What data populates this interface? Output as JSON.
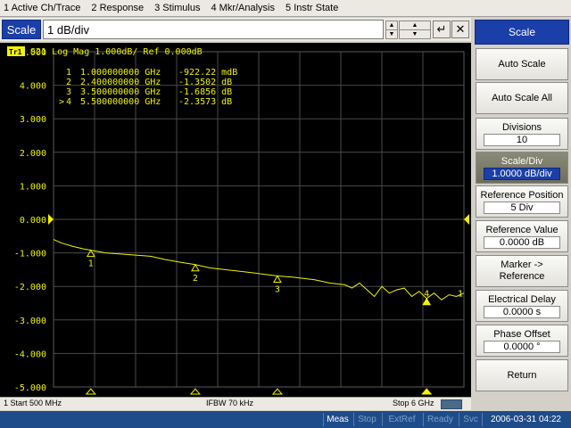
{
  "menu": [
    "1 Active Ch/Trace",
    "2 Response",
    "3 Stimulus",
    "4 Mkr/Analysis",
    "5 Instr State"
  ],
  "entry": {
    "label": "Scale",
    "value": "1 dB/div"
  },
  "trace": {
    "tag": "Tr1",
    "header": "S21 Log Mag 1.000dB/ Ref 0.000dB",
    "color": "#f2f200"
  },
  "markers": [
    {
      "num": "1",
      "prefix": " ",
      "freq": "1.000000000 GHz",
      "value": "-922.22 mdB"
    },
    {
      "num": "2",
      "prefix": " ",
      "freq": "2.400000000 GHz",
      "value": "-1.3502 dB"
    },
    {
      "num": "3",
      "prefix": " ",
      "freq": "3.500000000 GHz",
      "value": "-1.6856 dB"
    },
    {
      "num": "4",
      "prefix": ">",
      "freq": "5.500000000 GHz",
      "value": "-2.3573 dB"
    }
  ],
  "chart_data": {
    "type": "line",
    "y_ticks": [
      "5.000",
      "4.000",
      "3.000",
      "2.000",
      "1.000",
      "0.000",
      "-1.000",
      "-2.000",
      "-3.000",
      "-4.000",
      "-5.000"
    ],
    "ylim": [
      -5,
      5
    ],
    "xlim": [
      0.5,
      6
    ],
    "x_unit": "GHz",
    "grid": true,
    "reference_level": 0,
    "series": [
      {
        "x": [
          0.5,
          0.6,
          0.75,
          0.9,
          1.0,
          1.2,
          1.5,
          1.8,
          2.0,
          2.2,
          2.4,
          2.6,
          2.8,
          3.0,
          3.2,
          3.5,
          3.7,
          4.0,
          4.2,
          4.4,
          4.5,
          4.6,
          4.7,
          4.8,
          4.9,
          5.0,
          5.1,
          5.2,
          5.3,
          5.4,
          5.5,
          5.6,
          5.7,
          5.8,
          5.9,
          6.0
        ],
        "y": [
          -0.6,
          -0.7,
          -0.8,
          -0.88,
          -0.92,
          -1.0,
          -1.05,
          -1.1,
          -1.2,
          -1.28,
          -1.35,
          -1.45,
          -1.5,
          -1.55,
          -1.6,
          -1.69,
          -1.72,
          -1.8,
          -1.9,
          -1.95,
          -2.05,
          -1.9,
          -2.1,
          -2.3,
          -2.0,
          -2.2,
          -2.1,
          -2.05,
          -2.3,
          -2.15,
          -2.36,
          -2.2,
          -2.4,
          -2.25,
          -2.3,
          -2.2
        ]
      }
    ],
    "marker_points": [
      {
        "label": "1",
        "x": 1.0,
        "y": -0.92
      },
      {
        "label": "2",
        "x": 2.4,
        "y": -1.35
      },
      {
        "label": "3",
        "x": 3.5,
        "y": -1.69
      },
      {
        "label": "4",
        "x": 5.5,
        "y": -2.36
      }
    ]
  },
  "status": {
    "start": "1  Start 500 MHz",
    "ifbw": "IFBW 70 kHz",
    "stop": "Stop 6 GHz"
  },
  "bottom": {
    "cells": [
      "Meas",
      "Stop",
      "ExtRef",
      "Ready",
      "Svc"
    ],
    "datetime": "2006-03-31 04:22"
  },
  "softkeys": {
    "title": "Scale",
    "auto_scale": "Auto Scale",
    "auto_scale_all": "Auto Scale All",
    "divisions_label": "Divisions",
    "divisions_value": "10",
    "scale_div_label": "Scale/Div",
    "scale_div_value": "1.0000 dB/div",
    "ref_pos_label": "Reference Position",
    "ref_pos_value": "5 Div",
    "ref_val_label": "Reference Value",
    "ref_val_value": "0.0000 dB",
    "marker_ref_line1": "Marker ->",
    "marker_ref_line2": "Reference",
    "elec_delay_label": "Electrical Delay",
    "elec_delay_value": "0.0000 s",
    "phase_offset_label": "Phase Offset",
    "phase_offset_value": "0.0000 °",
    "return": "Return"
  },
  "colors": {
    "accent": "#1b3fa8",
    "trace": "#f2f200",
    "grid": "#4a4a4a",
    "status_on": "#ffffff",
    "status_off": "#7fa0c8"
  }
}
